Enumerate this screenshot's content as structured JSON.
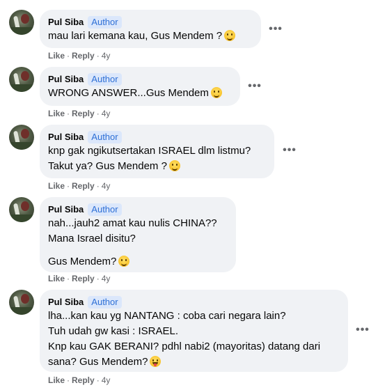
{
  "comments": [
    {
      "author_name": "Pul Siba",
      "badge": "Author",
      "lines": [
        "mau lari kemana kau, Gus Mendem ?"
      ],
      "emoji": "grinning-face",
      "like": "Like",
      "reply": "Reply",
      "time": "4y",
      "more": "•••"
    },
    {
      "author_name": "Pul Siba",
      "badge": "Author",
      "lines": [
        "WRONG ANSWER...Gus Mendem"
      ],
      "emoji": "smiling-face",
      "like": "Like",
      "reply": "Reply",
      "time": "4y",
      "more": "•••"
    },
    {
      "author_name": "Pul Siba",
      "badge": "Author",
      "lines": [
        "knp gak ngikutsertakan ISRAEL dlm listmu?",
        "Takut ya? Gus Mendem ?"
      ],
      "emoji": "smiling-face",
      "like": "Like",
      "reply": "Reply",
      "time": "4y",
      "more": "•••"
    },
    {
      "author_name": "Pul Siba",
      "badge": "Author",
      "lines": [
        "nah...jauh2 amat kau nulis CHINA??",
        "Mana Israel disitu?",
        "Gus Mendem?"
      ],
      "emoji": "grinning-face",
      "like": "Like",
      "reply": "Reply",
      "time": "4y"
    },
    {
      "author_name": "Pul Siba",
      "badge": "Author",
      "lines": [
        "lha...kan kau yg NANTANG : coba cari negara lain?",
        "Tuh udah gw kasi : ISRAEL.",
        "Knp kau GAK BERANI? pdhl nabi2 (mayoritas) datang dari",
        "sana? Gus Mendem?"
      ],
      "emoji": "face-with-tongue",
      "like": "Like",
      "reply": "Reply",
      "time": "4y",
      "more": "•••"
    }
  ]
}
